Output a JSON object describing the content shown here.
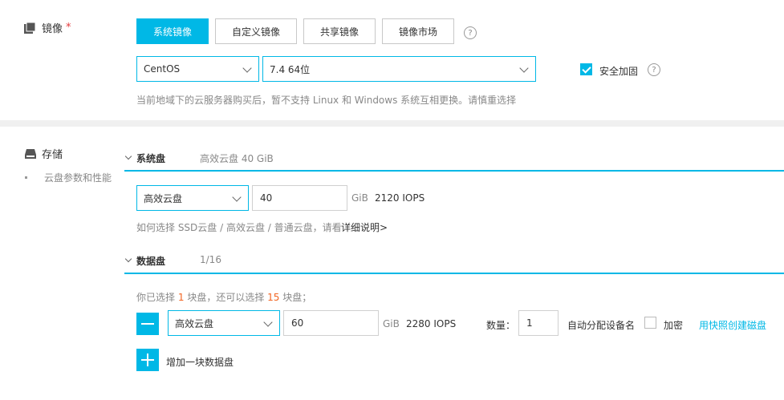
{
  "image": {
    "heading": "镜像",
    "required_mark": "*",
    "tabs": [
      "系统镜像",
      "自定义镜像",
      "共享镜像",
      "镜像市场"
    ],
    "help": "?",
    "os_select": "CentOS",
    "version_select": "7.4 64位",
    "security_label": "安全加固",
    "notice": "当前地域下的云服务器购买后，暂不支持 Linux 和 Windows 系统互相更换。请慎重选择"
  },
  "storage": {
    "heading": "存储",
    "sub_item": "云盘参数和性能",
    "system_disk": {
      "title": "系统盘",
      "summary": "高效云盘   40 GiB",
      "type": "高效云盘",
      "size": "40",
      "unit": "GiB",
      "iops": "2120 IOPS",
      "help_text": "如何选择 SSD云盘 / 高效云盘 / 普通云盘，请看",
      "help_link": "详细说明>"
    },
    "data_disk": {
      "title": "数据盘",
      "summary": "1/16",
      "sel_prefix": "你已选择",
      "sel_count": "1",
      "sel_mid": "块盘，还可以选择",
      "sel_remain": "15",
      "sel_suffix": "块盘；",
      "type": "高效云盘",
      "size": "60",
      "unit": "GiB",
      "iops": "2280 IOPS",
      "qty_label": "数量：",
      "qty": "1",
      "auto_label": "自动分配设备名",
      "encrypt_label": "加密",
      "snapshot_link": "用快照创建磁盘",
      "add_label": "增加一块数据盘"
    }
  },
  "colors": {
    "accent": "#00b8e6",
    "highlight": "#f26522"
  },
  "icons": [
    "image-icon",
    "storage-icon",
    "help-icon",
    "chevron-down-icon",
    "check-icon",
    "minus-icon",
    "plus-icon"
  ]
}
